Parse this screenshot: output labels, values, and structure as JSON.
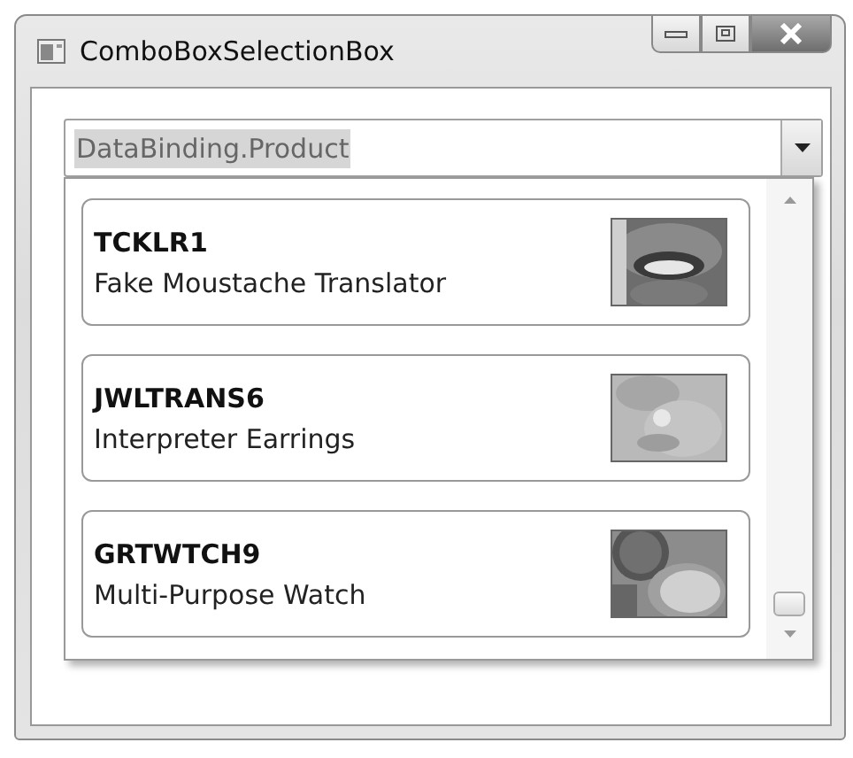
{
  "window": {
    "title": "ComboBoxSelectionBox"
  },
  "combo_box": {
    "value": "DataBinding.Product",
    "expanded": true
  },
  "products": [
    {
      "code": "TCKLR1",
      "name": "Fake Moustache Translator"
    },
    {
      "code": "JWLTRANS6",
      "name": "Interpreter Earrings"
    },
    {
      "code": "GRTWTCH9",
      "name": "Multi-Purpose Watch"
    }
  ]
}
